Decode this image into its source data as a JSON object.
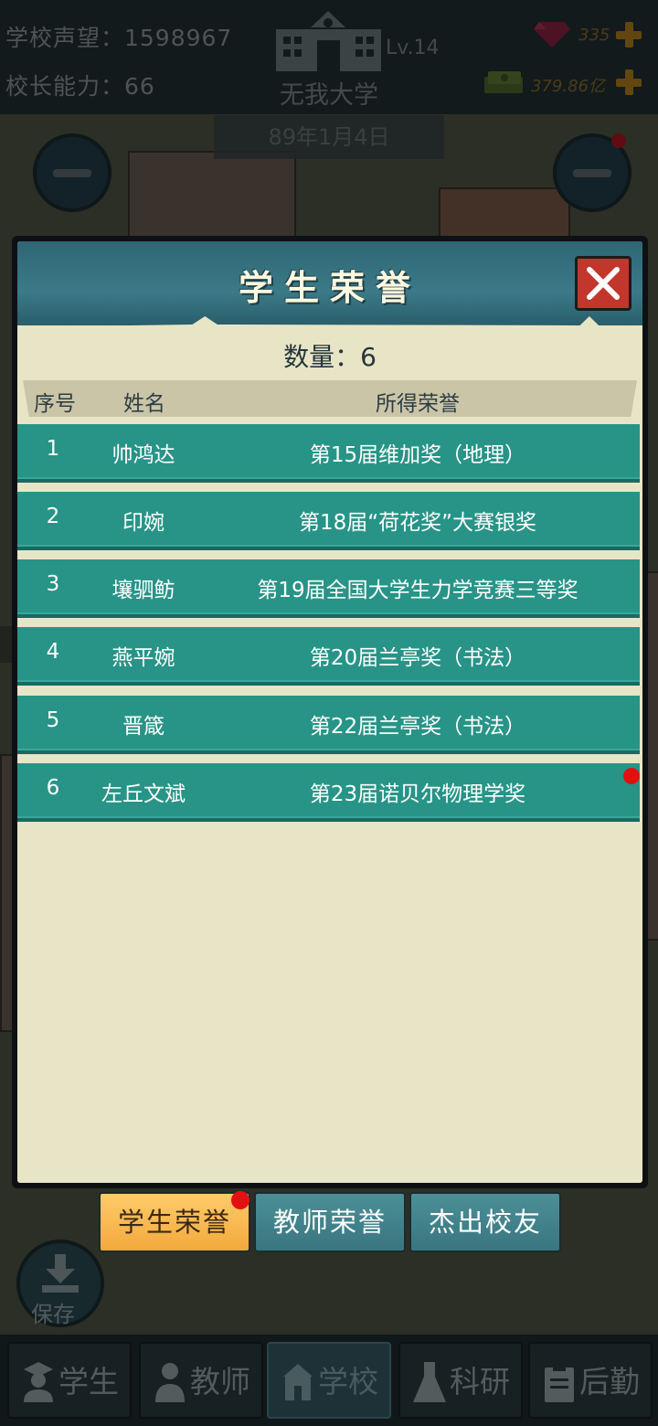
{
  "topbar": {
    "reputation": "学校声望：1598967",
    "principal_ability": "校长能力：66",
    "school_level": "Lv.14",
    "school_name": "无我大学",
    "gems": "335",
    "cash": "379.86亿",
    "date": "89年1月4日"
  },
  "modal": {
    "title": "学生荣誉",
    "count_label": "数量：6",
    "columns": {
      "num": "序号",
      "name": "姓名",
      "honor": "所得荣誉"
    },
    "rows": [
      {
        "num": "1",
        "name": "帅鸿达",
        "honor": "第15届维加奖（地理）"
      },
      {
        "num": "2",
        "name": "印婉",
        "honor": "第18届“荷花奖”大赛银奖"
      },
      {
        "num": "3",
        "name": "壤驷鲂",
        "honor": "第19届全国大学生力学竞赛三等奖"
      },
      {
        "num": "4",
        "name": "燕平婉",
        "honor": "第20届兰亭奖（书法）"
      },
      {
        "num": "5",
        "name": "晋箴",
        "honor": "第22届兰亭奖（书法）"
      },
      {
        "num": "6",
        "name": "左丘文斌",
        "honor": "第23届诺贝尔物理学奖"
      }
    ]
  },
  "tabs": {
    "student": "学生荣誉",
    "teacher": "教师荣誉",
    "alumni": "杰出校友"
  },
  "save_label": "保存",
  "nav": {
    "student": "学生",
    "teacher": "教师",
    "school": "学校",
    "research": "科研",
    "logistics": "后勤"
  },
  "colors": {
    "row": "#279487",
    "accent_tab": "#f2a93c",
    "close": "#c3362b",
    "badge": "#e21111"
  }
}
